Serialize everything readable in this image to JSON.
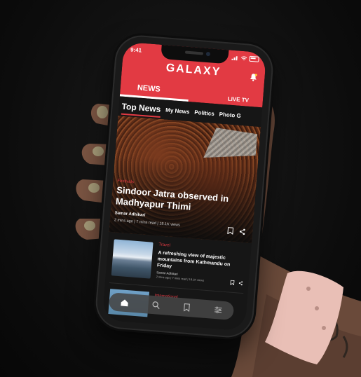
{
  "colors": {
    "accent": "#e23a43",
    "background": "#161616",
    "text": "#ffffff"
  },
  "status_bar": {
    "time": "9:41"
  },
  "header": {
    "logo": "GALAXY",
    "notification_icon": "bell-icon"
  },
  "main_tabs": [
    {
      "label": "NEWS",
      "active": true
    },
    {
      "label": "LIVE TV",
      "active": false
    }
  ],
  "categories": [
    {
      "label": "Top News",
      "active": true
    },
    {
      "label": "My News"
    },
    {
      "label": "Politics"
    },
    {
      "label": "Photo G"
    }
  ],
  "hero": {
    "tag": "Festivals",
    "title": "Sindoor Jatra observed in Madhyapur Thimi",
    "author": "Samar Adhikari",
    "meta": "2 mins ago | 7 mins read | 18.1K views"
  },
  "articles": [
    {
      "tag": "Travel",
      "title": "A refreshing view of majestic mountains from Kathmandu on Friday",
      "author": "Samar Adhikari",
      "meta": "2 mins ago | 7 mins read | 18.1K views"
    },
    {
      "tag": "International"
    }
  ],
  "bottom_nav": [
    {
      "icon": "home-icon"
    },
    {
      "icon": "search-icon"
    },
    {
      "icon": "bookmark-icon"
    },
    {
      "icon": "filter-icon"
    }
  ]
}
